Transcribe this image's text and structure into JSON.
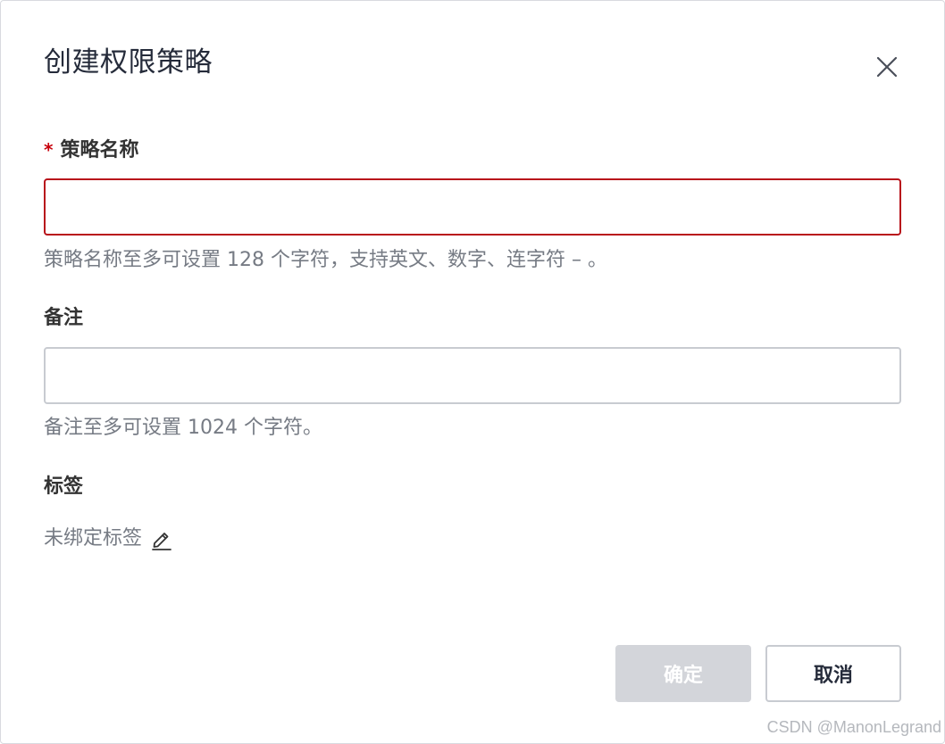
{
  "dialog": {
    "title": "创建权限策略",
    "close_icon": "close-icon"
  },
  "form": {
    "policy_name": {
      "required_mark": "*",
      "label": "策略名称",
      "value": "",
      "placeholder": "",
      "hint": "策略名称至多可设置 128 个字符，支持英文、数字、连字符 – 。",
      "state": "error"
    },
    "remark": {
      "label": "备注",
      "value": "",
      "placeholder": "",
      "hint": "备注至多可设置 1024 个字符。"
    },
    "tags": {
      "label": "标签",
      "status_text": "未绑定标签",
      "edit_icon": "edit-icon"
    }
  },
  "footer": {
    "confirm_label": "确定",
    "cancel_label": "取消"
  },
  "watermark": "CSDN @ManonLegrand",
  "colors": {
    "required": "#c7000b",
    "error_border": "#b8121b",
    "disabled_button": "#d3d5da",
    "hint_text": "#767b84"
  }
}
